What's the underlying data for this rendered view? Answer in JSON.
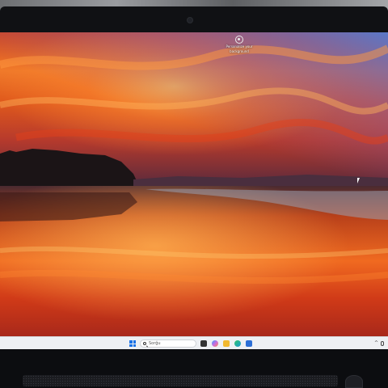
{
  "desktop": {
    "icons": [
      {
        "name": "recycle-bin",
        "label_line1": "Personalize your",
        "label_line2": "background"
      }
    ]
  },
  "taskbar": {
    "search_placeholder": "Sorğu",
    "pinned_apps": [
      {
        "icon": "file-explorer-icon",
        "color": "#333333"
      },
      {
        "icon": "copilot-icon",
        "color": "#c86be0"
      },
      {
        "icon": "folder-icon",
        "color": "#f2b92f"
      },
      {
        "icon": "edge-icon",
        "color": "#1a9ad8"
      },
      {
        "icon": "store-icon",
        "color": "#2c6fd6"
      }
    ],
    "tray": {
      "chevron": "^"
    }
  },
  "colors": {
    "accent": "#1a73e8",
    "taskbar_bg": "#eef0f3"
  }
}
